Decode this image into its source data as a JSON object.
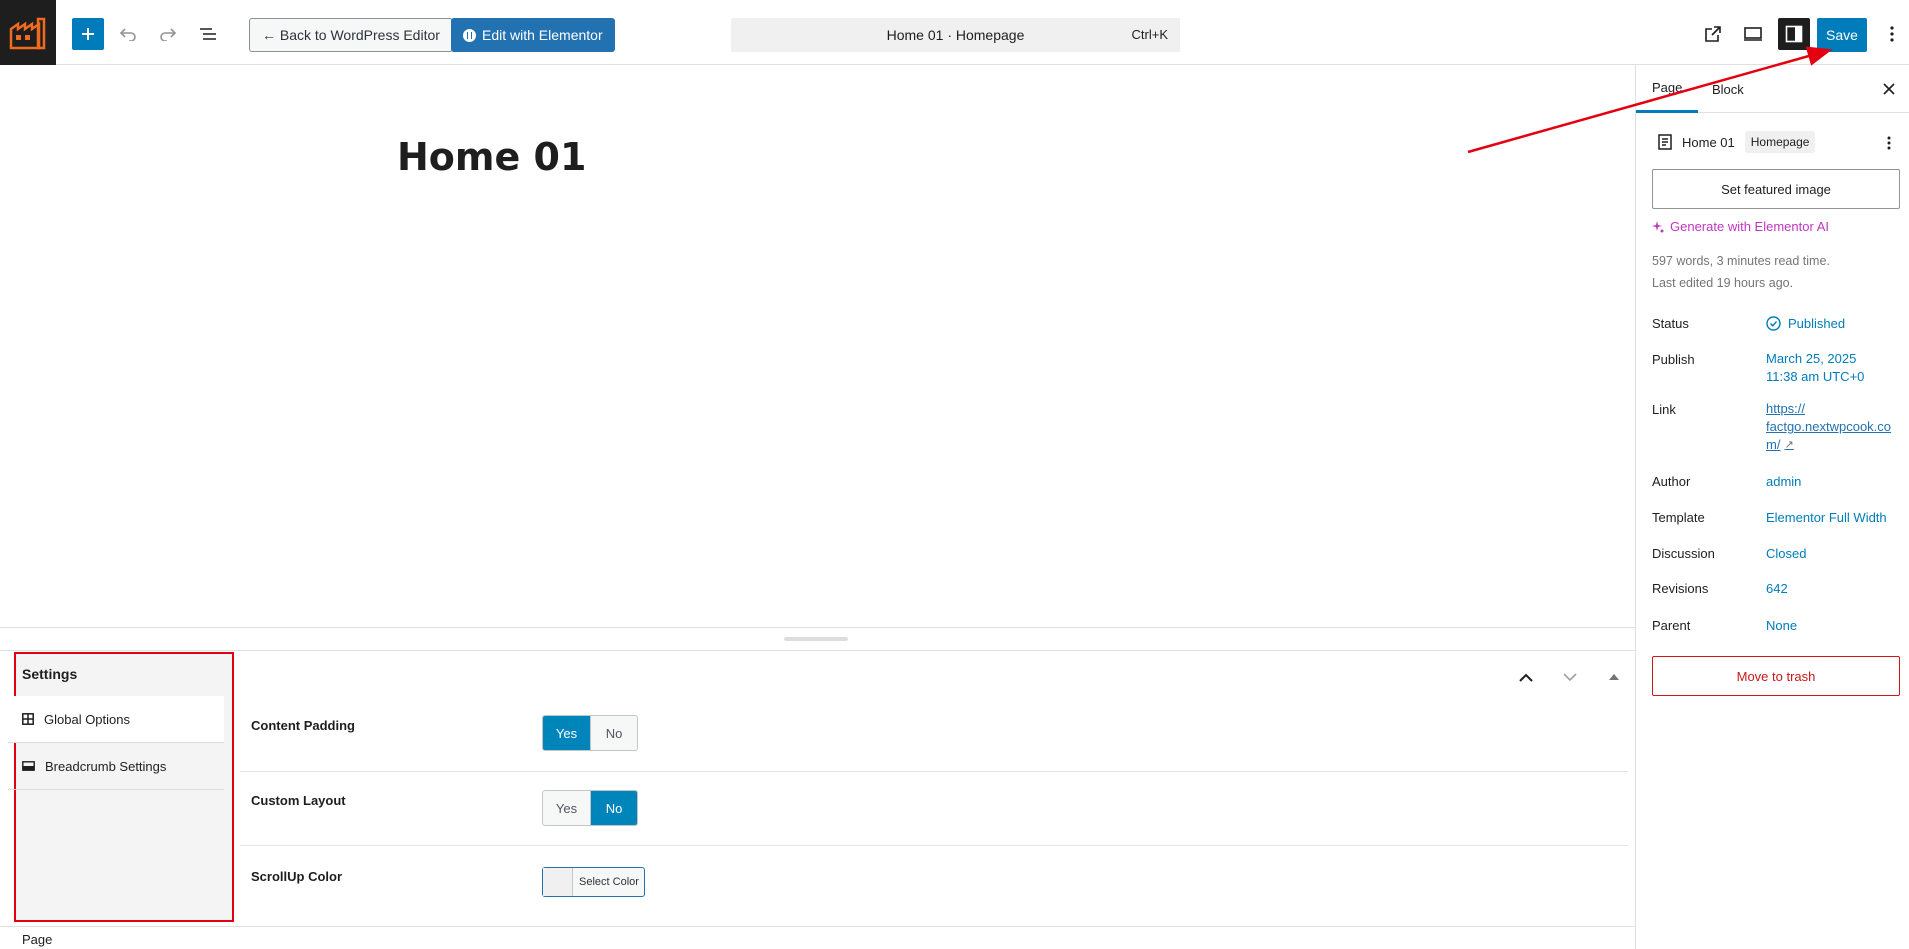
{
  "toolbar": {
    "back_label": "← Back to WordPress Editor",
    "elementor_label": "Edit with Elementor",
    "command_title": "Home 01 · Homepage",
    "command_shortcut": "Ctrl+K",
    "save_label": "Save"
  },
  "canvas": {
    "title": "Home 01"
  },
  "metabox": {
    "nav_title": "Settings",
    "nav_items": [
      {
        "label": "Global Options",
        "icon": "grid-icon"
      },
      {
        "label": "Breadcrumb Settings",
        "icon": "card-icon"
      }
    ],
    "rows": [
      {
        "label": "Content Padding",
        "options": [
          "Yes",
          "No"
        ],
        "selected": "Yes"
      },
      {
        "label": "Custom Layout",
        "options": [
          "Yes",
          "No"
        ],
        "selected": "No"
      },
      {
        "label": "ScrollUp Color",
        "button": "Select Color"
      }
    ],
    "footer": "Page"
  },
  "sidebar": {
    "tabs": [
      "Page",
      "Block"
    ],
    "active_tab": "Page",
    "page_name": "Home 01",
    "page_badge": "Homepage",
    "featured_button": "Set featured image",
    "ai_link": "Generate with Elementor AI",
    "word_info": "597 words, 3 minutes read time.",
    "last_edited": "Last edited 19 hours ago.",
    "fields": {
      "status_label": "Status",
      "status_value": "Published",
      "publish_label": "Publish",
      "publish_date": "March 25, 2025",
      "publish_time": "11:38 am UTC+0",
      "link_label": "Link",
      "link_line1": "https://",
      "link_line2": "factgo.nextwpcook.co",
      "link_line3": "m/",
      "author_label": "Author",
      "author_value": "admin",
      "template_label": "Template",
      "template_value": "Elementor Full Width",
      "discussion_label": "Discussion",
      "discussion_value": "Closed",
      "revisions_label": "Revisions",
      "revisions_value": "642",
      "parent_label": "Parent",
      "parent_value": "None"
    },
    "trash_button": "Move to trash"
  },
  "colors": {
    "accent": "#007cba",
    "annotation": "#e3000f",
    "ai": "#c036c0",
    "danger": "#cc1818"
  }
}
